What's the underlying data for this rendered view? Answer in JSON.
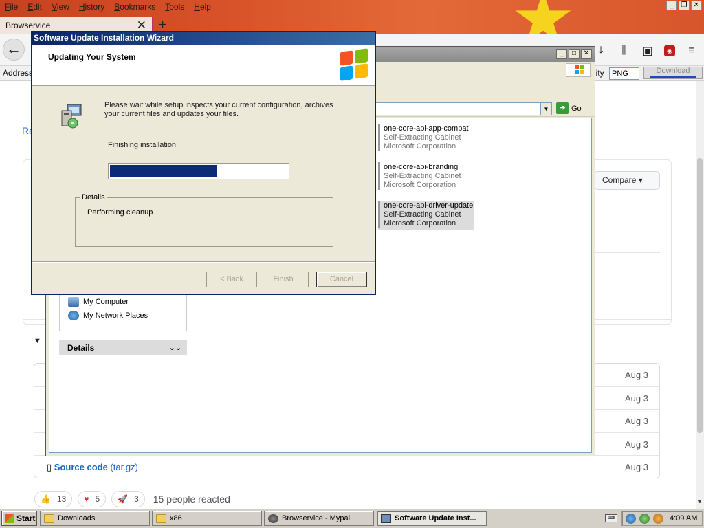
{
  "browser": {
    "menu": [
      "File",
      "Edit",
      "View",
      "History",
      "Bookmarks",
      "Tools",
      "Help"
    ],
    "tab_title": "Browservice",
    "tab_close": "✕",
    "new_tab": "+",
    "address_label": "Address",
    "quality_label": "lity",
    "format_value": "PNG",
    "download_label": "Download",
    "nav_icons": [
      "download-icon",
      "library-icon",
      "reader-icon",
      "ublock-icon",
      "menu-icon"
    ]
  },
  "page": {
    "top_link": "Re",
    "compare_label": "Compare",
    "assets": [
      {
        "date": "Aug 3"
      },
      {
        "date": "Aug 3"
      },
      {
        "date": "Aug 3"
      },
      {
        "date": "Aug 3"
      },
      {
        "name": "Source code",
        "ext": "(tar.gz)",
        "date": "Aug 3"
      }
    ],
    "reactions": [
      {
        "icon": "👍",
        "count": "13"
      },
      {
        "icon": "♥",
        "count": "5"
      },
      {
        "icon": "🚀",
        "count": "3"
      }
    ],
    "reacted_text": "15 people reacted"
  },
  "explorer": {
    "go_label": "Go",
    "files": [
      {
        "name": "one-core-api-app-compat",
        "type": "Self-Extracting Cabinet",
        "company": "Microsoft Corporation"
      },
      {
        "name": "one-core-api-branding",
        "type": "Self-Extracting Cabinet",
        "company": "Microsoft Corporation"
      },
      {
        "name": "one-core-api-driver-update",
        "type": "Self-Extracting Cabinet",
        "company": "Microsoft Corporation"
      }
    ],
    "places": [
      "My Computer",
      "My Network Places"
    ],
    "details_header": "Details"
  },
  "wizard": {
    "title": "Software Update Installation Wizard",
    "heading": "Updating Your System",
    "description": "Please wait while setup inspects your current configuration, archives your current files and updates your files.",
    "status": "Finishing installation",
    "progress_fraction": 0.6,
    "details_label": "Details",
    "details_text": "Performing cleanup",
    "back_label": "< Back",
    "finish_label": "Finish",
    "cancel_label": "Cancel"
  },
  "taskbar": {
    "start_label": "Start",
    "tasks": [
      {
        "label": "Downloads"
      },
      {
        "label": "x86"
      },
      {
        "label": "Browservice - Mypal"
      },
      {
        "label": "Software Update Inst..."
      }
    ],
    "clock": "4:09 AM"
  },
  "colors": {
    "xp_title_blue": "#0a246a",
    "progress_fill": "#0b2a78",
    "link_blue": "#1a66c8",
    "theme_orange": "#d9542a",
    "theme_star": "#f5d31e"
  }
}
